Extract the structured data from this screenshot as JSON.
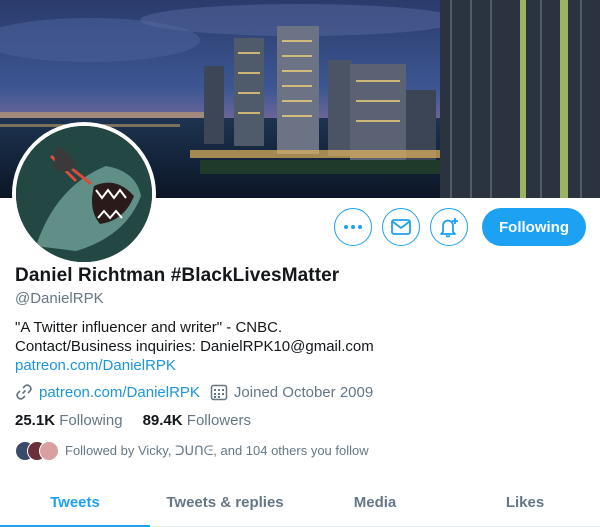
{
  "profile": {
    "name": "Daniel Richtman #BlackLivesMatter",
    "handle": "@DanielRPK",
    "bio_line1": "\"A Twitter influencer and writer\" - CNBC.",
    "bio_line2": "Contact/Business inquiries: DanielRPK10@gmail.com",
    "bio_link": "patreon.com/DanielRPK",
    "website": "patreon.com/DanielRPK",
    "joined": "Joined October 2009"
  },
  "stats": {
    "following_count": "25.1K",
    "following_label": "Following",
    "followers_count": "89.4K",
    "followers_label": "Followers"
  },
  "followed_by": "Followed by Vicky, ᑐᑌᑎᕮ, and 104 others you follow",
  "actions": {
    "more_icon": "more-icon",
    "message_icon": "envelope-icon",
    "notify_icon": "bell-plus-icon",
    "follow_label": "Following"
  },
  "tabs": [
    {
      "label": "Tweets",
      "active": true
    },
    {
      "label": "Tweets & replies",
      "active": false
    },
    {
      "label": "Media",
      "active": false
    },
    {
      "label": "Likes",
      "active": false
    }
  ],
  "colors": {
    "accent": "#1da1f2",
    "link": "#1b95e0",
    "secondary_text": "#657786"
  }
}
